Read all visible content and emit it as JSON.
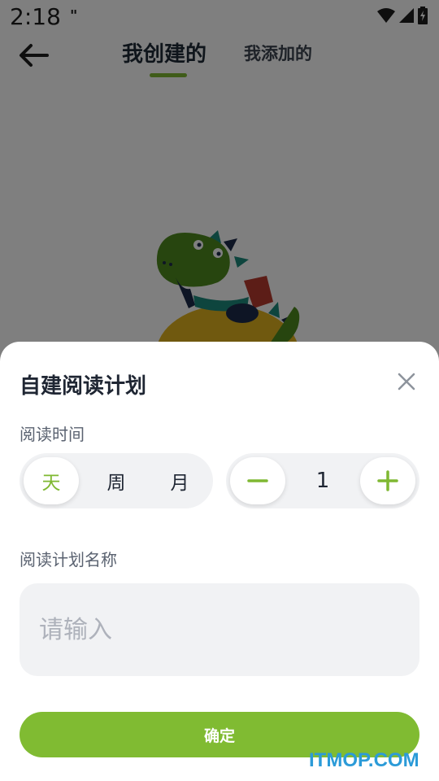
{
  "status_bar": {
    "time": "2:18",
    "pause_glyph": "\""
  },
  "nav": {
    "tab_created": "我创建的",
    "tab_added": "我添加的"
  },
  "sheet": {
    "title": "自建阅读计划",
    "reading_time_label": "阅读时间",
    "periods": [
      "天",
      "周",
      "月"
    ],
    "selected_period": "天",
    "count_value": "1",
    "plan_name_label": "阅读计划名称",
    "plan_name_placeholder": "请输入",
    "plan_name_value": "",
    "confirm_label": "确定"
  },
  "watermark": "ITMOP.COM",
  "colors": {
    "accent": "#80bb32",
    "field_bg": "#f1f2f4"
  }
}
